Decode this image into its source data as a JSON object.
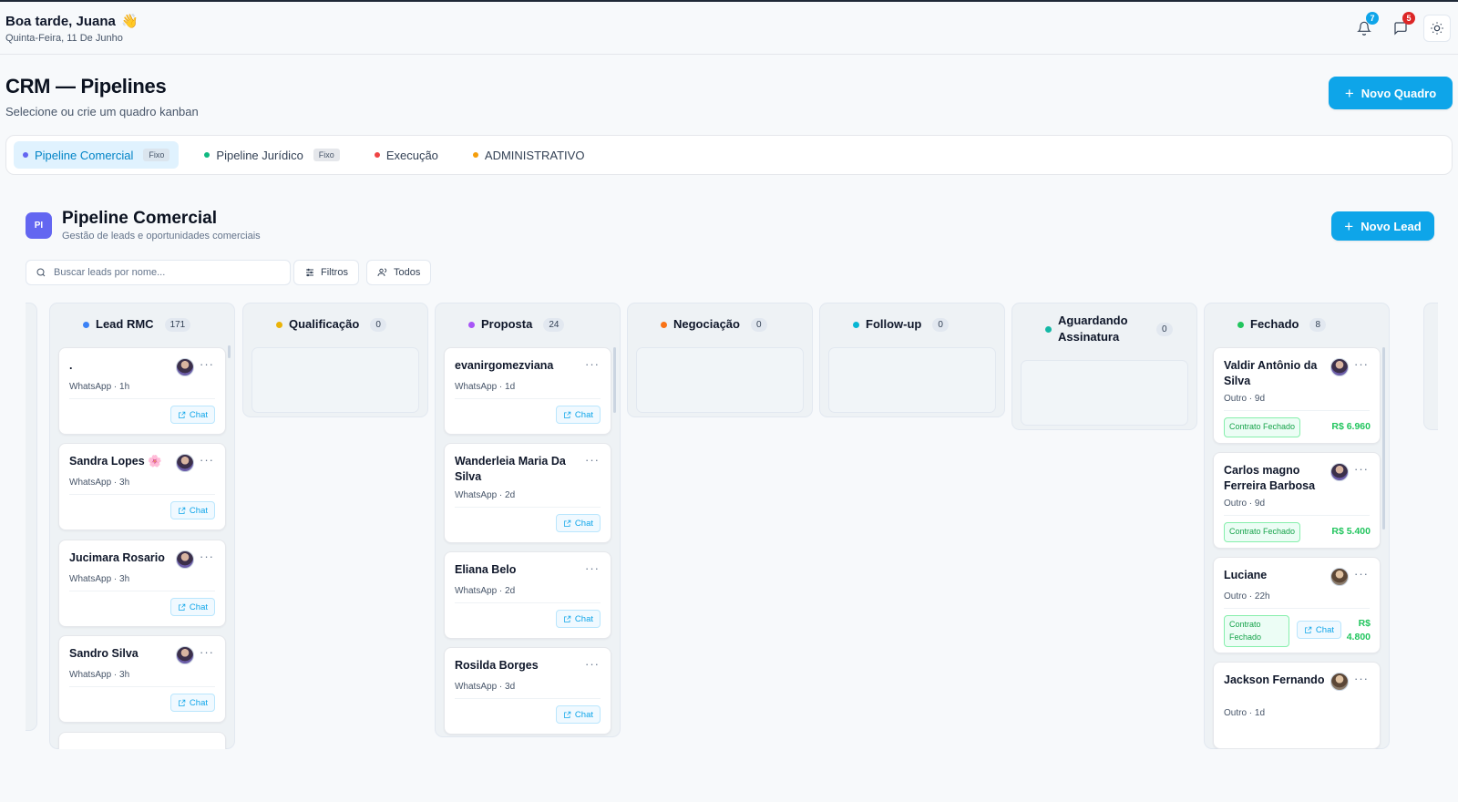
{
  "header": {
    "greeting": "Boa tarde, Juana",
    "wave": "👋",
    "date": "Quinta-Feira, 11 De Junho",
    "notifications_count": "7",
    "messages_count": "5"
  },
  "page": {
    "title": "CRM — Pipelines",
    "subtitle": "Selecione ou crie um quadro kanban",
    "new_board_label": "Novo Quadro"
  },
  "tabs": [
    {
      "label": "Pipeline Comercial",
      "badge": "Fixo",
      "color": "#6366f1"
    },
    {
      "label": "Pipeline Jurídico",
      "badge": "Fixo",
      "color": "#10b981"
    },
    {
      "label": "Execução",
      "color": "#ef4444"
    },
    {
      "label": "ADMINISTRATIVO",
      "color": "#f59e0b"
    }
  ],
  "board": {
    "icon_text": "PI",
    "title": "Pipeline Comercial",
    "subtitle": "Gestão de leads e oportunidades comerciais",
    "new_lead_label": "Novo Lead",
    "search_placeholder": "Buscar leads por nome...",
    "filters_label": "Filtros",
    "owner_filter_label": "Todos"
  },
  "columns": [
    {
      "name": "Lead RMC",
      "count": "171",
      "color": "#3b82f6",
      "cards": [
        {
          "name": ".",
          "meta": "WhatsApp · 1h",
          "action": "Chat"
        },
        {
          "name": "Sandra Lopes 🌸",
          "meta": "WhatsApp · 3h",
          "action": "Chat"
        },
        {
          "name": "Jucimara Rosario",
          "meta": "WhatsApp · 3h",
          "action": "Chat"
        },
        {
          "name": "Sandro Silva",
          "meta": "WhatsApp · 3h",
          "action": "Chat"
        }
      ]
    },
    {
      "name": "Qualificação",
      "count": "0",
      "color": "#eab308",
      "cards": []
    },
    {
      "name": "Proposta",
      "count": "24",
      "color": "#a855f7",
      "cards": [
        {
          "name": "evanirgomezviana",
          "meta": "WhatsApp · 1d",
          "action": "Chat"
        },
        {
          "name": "Wanderleia Maria Da Silva",
          "meta": "WhatsApp · 2d",
          "action": "Chat"
        },
        {
          "name": "Eliana Belo",
          "meta": "WhatsApp · 2d",
          "action": "Chat"
        },
        {
          "name": "Rosilda Borges",
          "meta": "WhatsApp · 3d",
          "action": "Chat"
        }
      ]
    },
    {
      "name": "Negociação",
      "count": "0",
      "color": "#f97316",
      "cards": []
    },
    {
      "name": "Follow-up",
      "count": "0",
      "color": "#06b6d4",
      "cards": []
    },
    {
      "name": "Aguardando Assinatura",
      "count": "0",
      "color": "#14b8a6",
      "cards": []
    },
    {
      "name": "Fechado",
      "count": "8",
      "color": "#22c55e",
      "cards": [
        {
          "name": "Valdir Antônio da Silva",
          "meta": "Outro · 9d",
          "tag": "Contrato Fechado",
          "value": "R$ 6.960"
        },
        {
          "name": "Carlos magno Ferreira Barbosa",
          "meta": "Outro · 9d",
          "tag": "Contrato Fechado",
          "value": "R$ 5.400"
        },
        {
          "name": "Luciane",
          "meta": "Outro · 22h",
          "tag": "Contrato Fechado",
          "action": "Chat",
          "value": "R$ 4.800"
        },
        {
          "name": "Jackson Fernando",
          "meta": "Outro · 1d"
        }
      ]
    }
  ]
}
